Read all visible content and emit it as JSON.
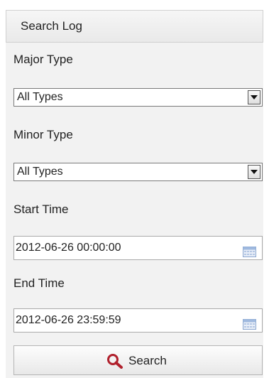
{
  "panel": {
    "title": "Search Log"
  },
  "major_type": {
    "label": "Major Type",
    "selected": "All Types"
  },
  "minor_type": {
    "label": "Minor Type",
    "selected": "All Types"
  },
  "start_time": {
    "label": "Start Time",
    "value": "2012-06-26 00:00:00"
  },
  "end_time": {
    "label": "End Time",
    "value": "2012-06-26 23:59:59"
  },
  "search_button": {
    "label": "Search"
  },
  "icons": {
    "dropdown": "chevron-down-icon",
    "calendar": "calendar-icon",
    "search": "search-icon"
  },
  "colors": {
    "search_icon": "#b0202c",
    "calendar_icon": "#7fa3d6"
  }
}
